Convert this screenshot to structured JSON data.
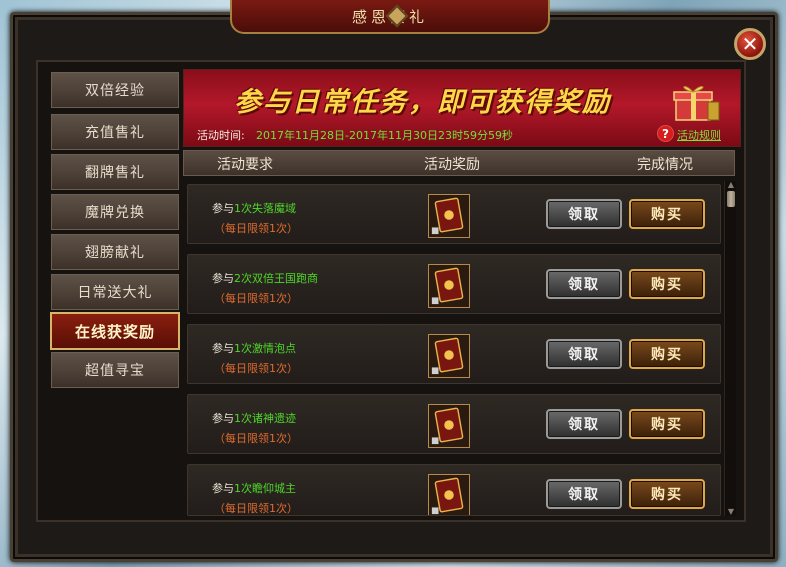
{
  "window": {
    "title": "感恩豪礼",
    "close_glyph": "✕"
  },
  "sidebar": {
    "items": [
      {
        "label": "双倍经验",
        "active": false
      },
      {
        "label": "充值售礼",
        "active": false
      },
      {
        "label": "翻牌售礼",
        "active": false
      },
      {
        "label": "魔牌兑换",
        "active": false
      },
      {
        "label": "翅膀献礼",
        "active": false
      },
      {
        "label": "日常送大礼",
        "active": false
      },
      {
        "label": "在线获奖励",
        "active": true
      },
      {
        "label": "超值寻宝",
        "active": false
      }
    ]
  },
  "banner": {
    "headline": "参与日常任务，即可获得奖励",
    "time_label": "活动时间:",
    "time_value": "2017年11月28日-2017年11月30日23时59分59秒",
    "help_glyph": "?",
    "rules_link": "活动规则"
  },
  "table": {
    "headers": [
      "活动要求",
      "活动奖励",
      "完成情况"
    ],
    "rows": [
      {
        "prefix": "参与",
        "highlight": "1次失落魔域",
        "limit": "（每日限领1次）",
        "claim": "领取",
        "buy": "购买"
      },
      {
        "prefix": "参与",
        "highlight": "2次双倍王国跑商",
        "limit": "（每日限领1次）",
        "claim": "领取",
        "buy": "购买"
      },
      {
        "prefix": "参与",
        "highlight": "1次激情泡点",
        "limit": "（每日限领1次）",
        "claim": "领取",
        "buy": "购买"
      },
      {
        "prefix": "参与",
        "highlight": "1次诸神遗迹",
        "limit": "（每日限领1次）",
        "claim": "领取",
        "buy": "购买"
      },
      {
        "prefix": "参与",
        "highlight": "1次瞻仰城主",
        "limit": "（每日限领1次）",
        "claim": "领取",
        "buy": "购买"
      }
    ]
  },
  "scroll": {
    "up": "▲",
    "down": "▼"
  },
  "colors": {
    "accent_green": "#4fd629",
    "limit_orange": "#e06b2e",
    "banner_red": "#b3182a",
    "headline_gold": "#ffd84a"
  }
}
